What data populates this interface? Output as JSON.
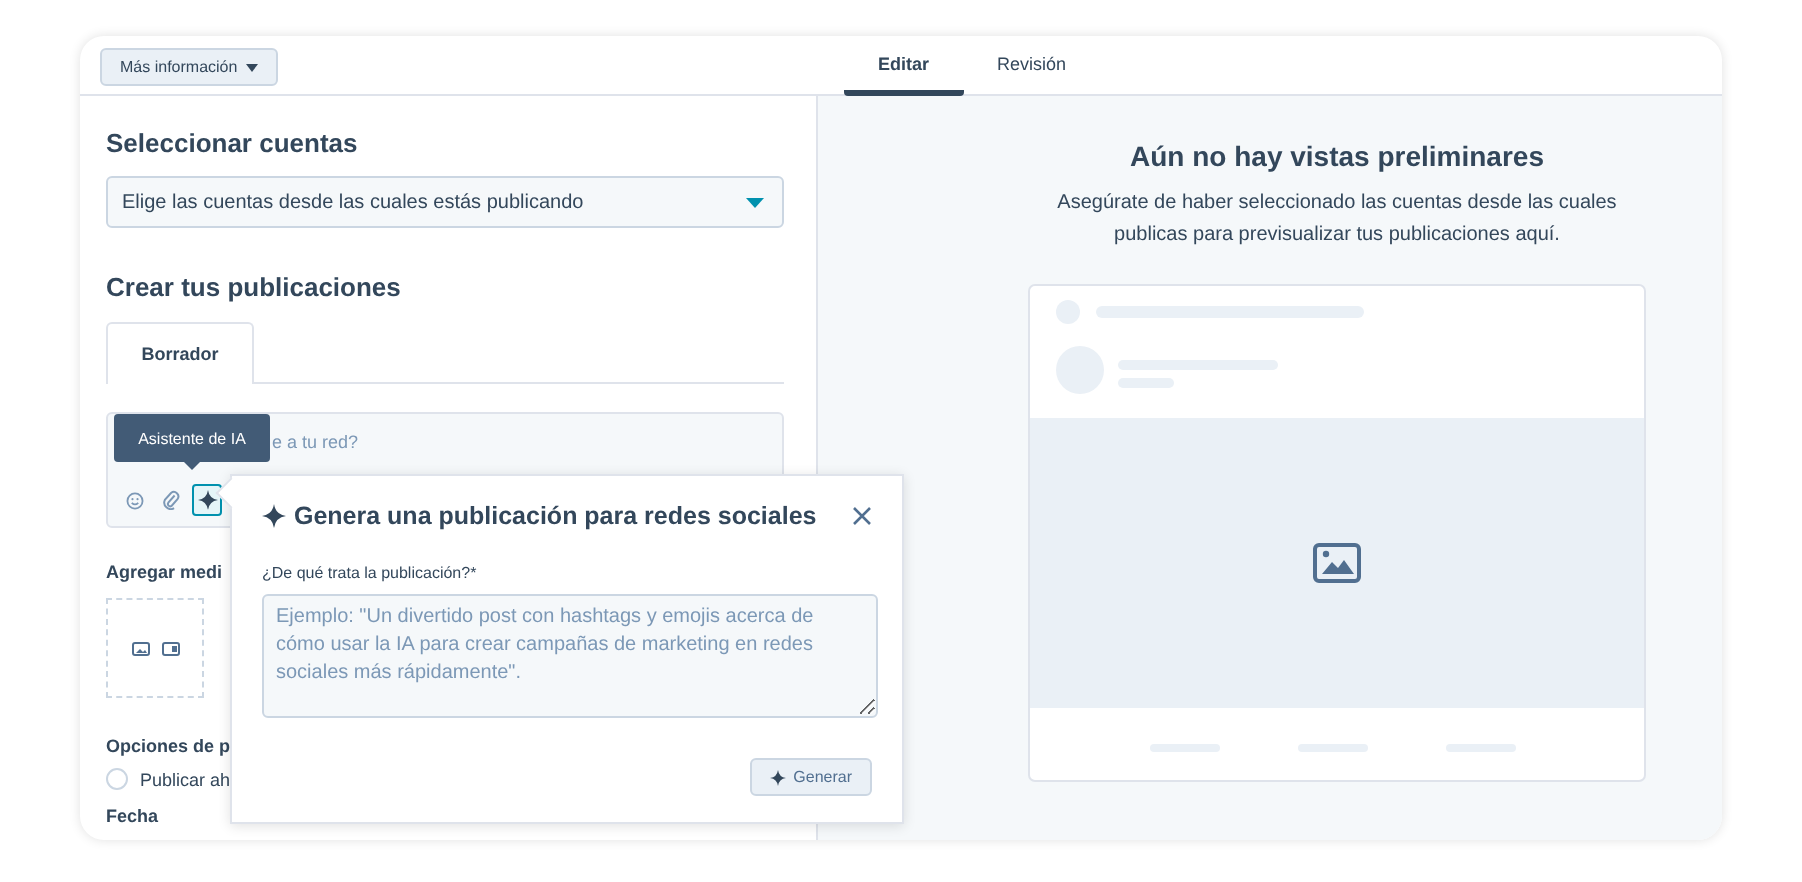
{
  "top_bar": {
    "more_info_button": "Más información",
    "tabs": [
      {
        "label": "Editar",
        "selected": true
      },
      {
        "label": "Revisión",
        "selected": false
      }
    ]
  },
  "accounts": {
    "heading": "Seleccionar cuentas",
    "dropdown": "Elige las cuentas desde las cuales estás publicando"
  },
  "create": {
    "heading": "Crear tus publicaciones",
    "tabs": [
      {
        "label": "Borrador",
        "selected": true
      }
    ],
    "composer": {
      "placeholder": "e a tu red?",
      "tools": [
        {
          "kind": "emoji",
          "selected": false
        },
        {
          "kind": "attach",
          "selected": false
        },
        {
          "kind": "ai",
          "selected": true
        }
      ]
    },
    "tooltip": "Asistente de IA"
  },
  "media": {
    "heading": "Agregar medi"
  },
  "options": {
    "heading": "Opciones de p",
    "radios": [
      {
        "label": "Publicar ah",
        "checked": false
      }
    ],
    "date_label": "Fecha"
  },
  "ai_popover": {
    "title": "Genera una publicación para redes sociales",
    "field_label": "¿De qué trata la publicación?*",
    "placeholder": "Ejemplo: \"Un divertido post con hashtags y emojis acerca de cómo usar la IA para crear campañas de marketing en redes sociales más rápidamente\".",
    "button": "Generar"
  },
  "preview": {
    "title": "Aún no hay vistas preliminares",
    "description": "Asegúrate de haber seleccionado las cuentas desde las cuales publicas para previsualizar tus publicaciones aquí."
  }
}
